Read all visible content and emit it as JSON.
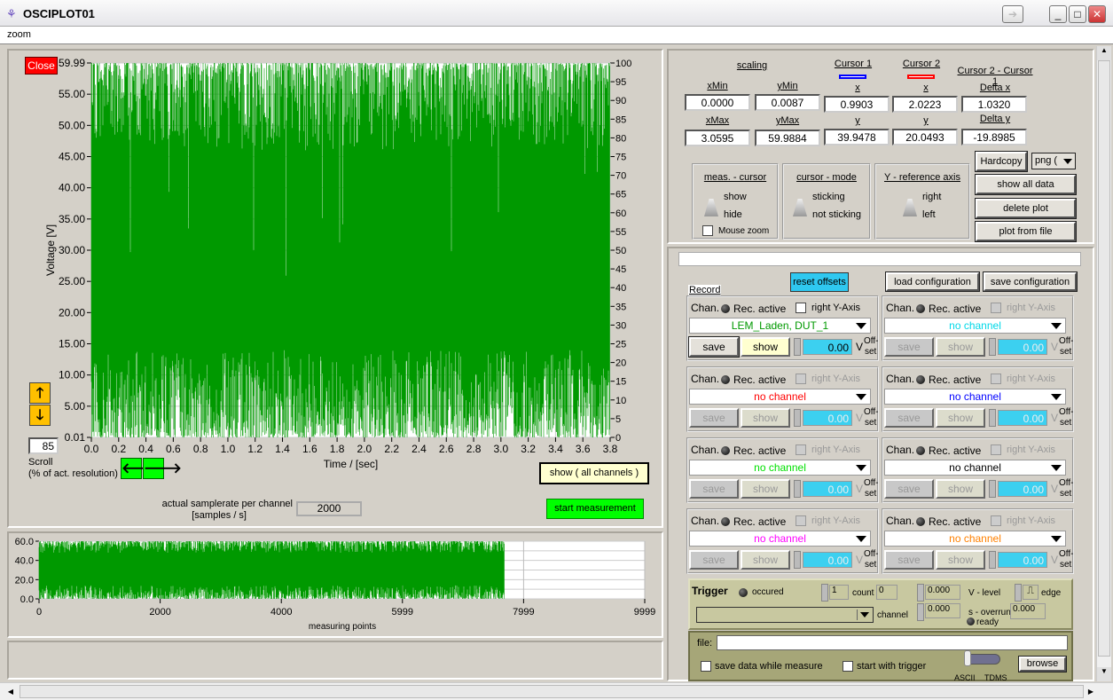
{
  "window": {
    "title": "OSCIPLOT01",
    "menu": "zoom"
  },
  "main_plot": {
    "close_label": "Close",
    "y_left_ticks": [
      "59.99",
      "55.00",
      "50.00",
      "45.00",
      "40.00",
      "35.00",
      "30.00",
      "25.00",
      "20.00",
      "15.00",
      "10.00",
      "5.00",
      "0.01"
    ],
    "y_right_ticks": [
      "100",
      "95",
      "90",
      "85",
      "80",
      "75",
      "70",
      "65",
      "60",
      "55",
      "50",
      "45",
      "40",
      "35",
      "30",
      "25",
      "20",
      "15",
      "10",
      "5",
      "0"
    ],
    "x_ticks": [
      "0.0",
      "0.2",
      "0.4",
      "0.6",
      "0.8",
      "1.0",
      "1.2",
      "1.4",
      "1.6",
      "1.8",
      "2.0",
      "2.2",
      "2.4",
      "2.6",
      "2.8",
      "3.0",
      "3.2",
      "3.4",
      "3.6",
      "3.8"
    ],
    "ylabel": "Voltage [V]",
    "xlabel": "Time / [sec]",
    "trace_color": "#009900",
    "scroll_value": "85",
    "scroll_label1": "Scroll",
    "scroll_label2": "(% of act. resolution)",
    "show_all_channels": "show ( all channels )"
  },
  "samplerate": {
    "label1": "actual samplerate per channel",
    "label2": "[samples / s]",
    "value": "2000"
  },
  "start_measurement": "start measurement",
  "overview_plot": {
    "y_ticks": [
      "60.0",
      "40.0",
      "20.0",
      "0.0"
    ],
    "x_ticks": [
      "0",
      "2000",
      "4000",
      "5999",
      "7999",
      "9999"
    ],
    "xlabel": "measuring points"
  },
  "scaling": {
    "title": "scaling",
    "xmin_label": "xMin",
    "xmin": "0.0000",
    "ymin_label": "yMin",
    "ymin": "0.0087",
    "xmax_label": "xMax",
    "xmax": "3.0595",
    "ymax_label": "yMax",
    "ymax": "59.9884"
  },
  "cursor1": {
    "title": "Cursor 1",
    "color": "#0000ff",
    "x_label": "x",
    "x": "0.9903",
    "y_label": "y",
    "y": "39.9478"
  },
  "cursor2": {
    "title": "Cursor 2",
    "color": "#ff0000",
    "x_label": "x",
    "x": "2.0223",
    "y_label": "y",
    "y": "20.0493"
  },
  "delta": {
    "title": "Cursor 2 - Cursor 1",
    "dx_label": "Delta x",
    "dx": "1.0320",
    "dy_label": "Delta y",
    "dy": "-19.8985"
  },
  "meas_cursor": {
    "title": "meas. - cursor",
    "opt1": "show",
    "opt2": "hide",
    "mouse_zoom": "Mouse zoom"
  },
  "cursor_mode": {
    "title": "cursor - mode",
    "opt1": "sticking",
    "opt2": "not sticking"
  },
  "y_ref": {
    "title": "Y - reference  axis",
    "opt1": "right",
    "opt2": "left"
  },
  "buttons": {
    "hardcopy": "Hardcopy",
    "format": "png (",
    "show_all_data": "show all data",
    "delete_plot": "delete plot",
    "plot_from_file": "plot from file",
    "reset_offsets": "reset offsets",
    "load_config": "load configuration",
    "save_config": "save configuration"
  },
  "record_label": "Record",
  "channel_labels": {
    "chan": "Chan.",
    "rec_active": "Rec. active",
    "right_y": "right Y-Axis",
    "save": "save",
    "show": "show",
    "unit": "V",
    "off1": "Off-",
    "off2": "set"
  },
  "channels": [
    {
      "name": "LEM_Laden, DUT_1",
      "color": "#009900",
      "offset": "0.00",
      "enabled": true
    },
    {
      "name": "no channel",
      "color": "#00d8e8",
      "offset": "0.00",
      "enabled": false
    },
    {
      "name": "no channel",
      "color": "#ff0000",
      "offset": "0.00",
      "enabled": false
    },
    {
      "name": "no channel",
      "color": "#0000ff",
      "offset": "0.00",
      "enabled": false
    },
    {
      "name": "no channel",
      "color": "#00e000",
      "offset": "0.00",
      "enabled": false
    },
    {
      "name": "no channel",
      "color": "#000000",
      "offset": "0.00",
      "enabled": false
    },
    {
      "name": "no channel",
      "color": "#ff00ff",
      "offset": "0.00",
      "enabled": false
    },
    {
      "name": "no channel",
      "color": "#ff8000",
      "offset": "0.00",
      "enabled": false
    }
  ],
  "trigger": {
    "title": "Trigger",
    "occured": "occured",
    "count_value": "1",
    "count_label": "count",
    "count_display": "0",
    "v_level": "0.000",
    "v_level_label": "V - level",
    "edge_label": "edge",
    "channel_label": "channel",
    "overrun": "0.000",
    "overrun_label": "s - overrun",
    "overrun_display": "0.000",
    "ready": "ready"
  },
  "file": {
    "label": "file:",
    "value": "",
    "save_while": "save data while measure",
    "start_trigger": "start with trigger",
    "fmt1": "ASCII",
    "fmt2": "TDMS",
    "browse": "browse"
  }
}
